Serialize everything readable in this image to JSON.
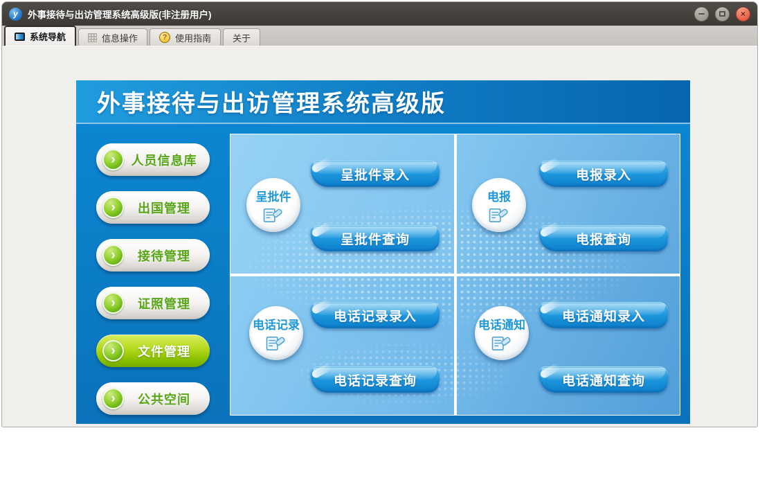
{
  "window": {
    "title": "外事接待与出访管理系统高级版(非注册用户)",
    "logo_glyph": "y",
    "close_glyph": "×"
  },
  "tabs": [
    {
      "label": "系统导航",
      "icon": "screen-icon",
      "active": true
    },
    {
      "label": "信息操作",
      "icon": "grid-icon",
      "active": false
    },
    {
      "label": "使用指南",
      "icon": "help-icon",
      "active": false
    },
    {
      "label": "关于",
      "icon": null,
      "active": false
    }
  ],
  "icons": {
    "help_glyph": "?",
    "chevron_glyph": "›"
  },
  "banner": {
    "title": "外事接待与出访管理系统高级版"
  },
  "sidebar": {
    "items": [
      {
        "label": "人员信息库",
        "selected": false
      },
      {
        "label": "出国管理",
        "selected": false
      },
      {
        "label": "接待管理",
        "selected": false
      },
      {
        "label": "证照管理",
        "selected": false
      },
      {
        "label": "文件管理",
        "selected": true
      },
      {
        "label": "公共空间",
        "selected": false
      }
    ]
  },
  "quadrants": [
    {
      "badge": "呈批件",
      "buttons": [
        "呈批件录入",
        "呈批件查询"
      ]
    },
    {
      "badge": "电报",
      "buttons": [
        "电报录入",
        "电报查询"
      ]
    },
    {
      "badge": "电话记录",
      "buttons": [
        "电话记录录入",
        "电话记录查询"
      ]
    },
    {
      "badge": "电话通知",
      "buttons": [
        "电话通知录入",
        "电话通知查询"
      ]
    }
  ],
  "colors": {
    "titlebar": "#45423d",
    "panel_blue": "#0b7cc5",
    "banner_left": "#219cdf",
    "banner_right": "#0665b0",
    "button_green": "#8fd02c",
    "selected_item_green": "#90c400",
    "action_button_blue": "#1e98de",
    "badge_text_blue": "#1f98da",
    "sidebar_text_green": "#58a517",
    "close_button": "#e45b3f"
  }
}
